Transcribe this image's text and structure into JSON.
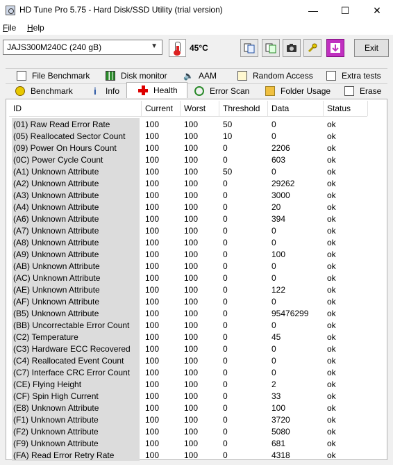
{
  "window": {
    "title": "HD Tune Pro 5.75 - Hard Disk/SSD Utility (trial version)"
  },
  "menu": {
    "file": "File",
    "help": "Help"
  },
  "toolbar": {
    "drive": "JAJS300M240C (240 gB)",
    "temperature": "45°C",
    "exit_label": "Exit"
  },
  "tabs_top": [
    "File Benchmark",
    "Disk monitor",
    "AAM",
    "Random Access",
    "Extra tests"
  ],
  "tabs_bottom": [
    "Benchmark",
    "Info",
    "Health",
    "Error Scan",
    "Folder Usage",
    "Erase"
  ],
  "active_tab": "Health",
  "table": {
    "headers": [
      "ID",
      "Current",
      "Worst",
      "Threshold",
      "Data",
      "Status"
    ],
    "rows": [
      [
        "(01) Raw Read Error Rate",
        "100",
        "100",
        "50",
        "0",
        "ok"
      ],
      [
        "(05) Reallocated Sector Count",
        "100",
        "100",
        "10",
        "0",
        "ok"
      ],
      [
        "(09) Power On Hours Count",
        "100",
        "100",
        "0",
        "2206",
        "ok"
      ],
      [
        "(0C) Power Cycle Count",
        "100",
        "100",
        "0",
        "603",
        "ok"
      ],
      [
        "(A1) Unknown Attribute",
        "100",
        "100",
        "50",
        "0",
        "ok"
      ],
      [
        "(A2) Unknown Attribute",
        "100",
        "100",
        "0",
        "29262",
        "ok"
      ],
      [
        "(A3) Unknown Attribute",
        "100",
        "100",
        "0",
        "3000",
        "ok"
      ],
      [
        "(A4) Unknown Attribute",
        "100",
        "100",
        "0",
        "20",
        "ok"
      ],
      [
        "(A6) Unknown Attribute",
        "100",
        "100",
        "0",
        "394",
        "ok"
      ],
      [
        "(A7) Unknown Attribute",
        "100",
        "100",
        "0",
        "0",
        "ok"
      ],
      [
        "(A8) Unknown Attribute",
        "100",
        "100",
        "0",
        "0",
        "ok"
      ],
      [
        "(A9) Unknown Attribute",
        "100",
        "100",
        "0",
        "100",
        "ok"
      ],
      [
        "(AB) Unknown Attribute",
        "100",
        "100",
        "0",
        "0",
        "ok"
      ],
      [
        "(AC) Unknown Attribute",
        "100",
        "100",
        "0",
        "0",
        "ok"
      ],
      [
        "(AE) Unknown Attribute",
        "100",
        "100",
        "0",
        "122",
        "ok"
      ],
      [
        "(AF) Unknown Attribute",
        "100",
        "100",
        "0",
        "0",
        "ok"
      ],
      [
        "(B5) Unknown Attribute",
        "100",
        "100",
        "0",
        "95476299",
        "ok"
      ],
      [
        "(BB) Uncorrectable Error Count",
        "100",
        "100",
        "0",
        "0",
        "ok"
      ],
      [
        "(C2) Temperature",
        "100",
        "100",
        "0",
        "45",
        "ok"
      ],
      [
        "(C3) Hardware ECC Recovered",
        "100",
        "100",
        "0",
        "0",
        "ok"
      ],
      [
        "(C4) Reallocated Event Count",
        "100",
        "100",
        "0",
        "0",
        "ok"
      ],
      [
        "(C7) Interface CRC Error Count",
        "100",
        "100",
        "0",
        "0",
        "ok"
      ],
      [
        "(CE) Flying Height",
        "100",
        "100",
        "0",
        "2",
        "ok"
      ],
      [
        "(CF) Spin High Current",
        "100",
        "100",
        "0",
        "33",
        "ok"
      ],
      [
        "(E8) Unknown Attribute",
        "100",
        "100",
        "0",
        "100",
        "ok"
      ],
      [
        "(F1) Unknown Attribute",
        "100",
        "100",
        "0",
        "3720",
        "ok"
      ],
      [
        "(F2) Unknown Attribute",
        "100",
        "100",
        "0",
        "5080",
        "ok"
      ],
      [
        "(F9) Unknown Attribute",
        "100",
        "100",
        "0",
        "681",
        "ok"
      ],
      [
        "(FA) Read Error Retry Rate",
        "100",
        "100",
        "0",
        "4318",
        "ok"
      ]
    ]
  }
}
